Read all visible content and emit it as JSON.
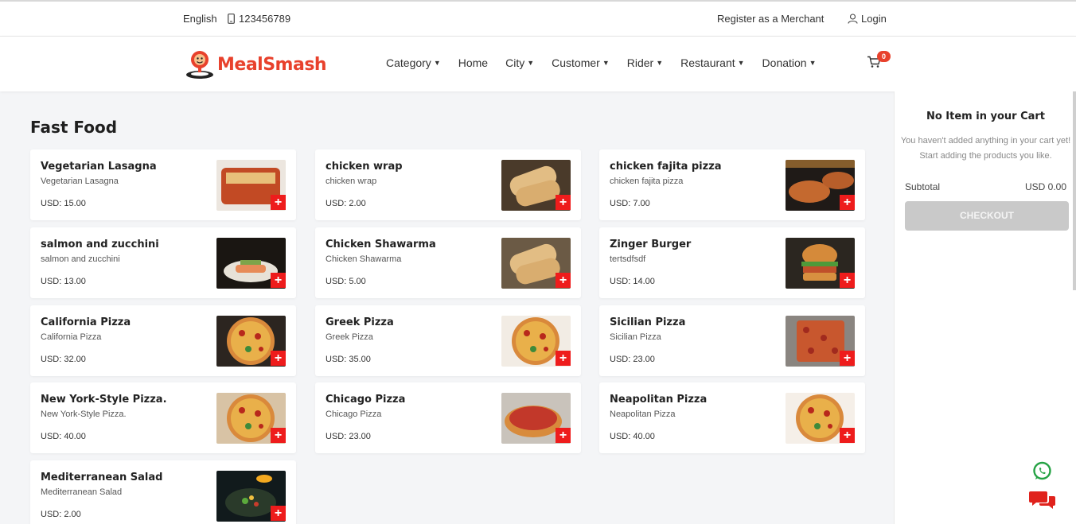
{
  "topbar": {
    "language": "English",
    "phone": "123456789",
    "register": "Register as a Merchant",
    "login": "Login"
  },
  "brand": {
    "name": "MealSmash",
    "color": "#e8412c"
  },
  "nav": {
    "items": [
      {
        "label": "Category",
        "dropdown": true
      },
      {
        "label": "Home",
        "dropdown": false
      },
      {
        "label": "City",
        "dropdown": true
      },
      {
        "label": "Customer",
        "dropdown": true
      },
      {
        "label": "Rider",
        "dropdown": true
      },
      {
        "label": "Restaurant",
        "dropdown": true
      },
      {
        "label": "Donation",
        "dropdown": true
      }
    ],
    "cart_count": "0"
  },
  "section": {
    "title": "Fast Food"
  },
  "products": [
    {
      "name": "Vegetarian Lasagna",
      "desc": "Vegetarian Lasagna",
      "price": "USD: 15.00",
      "img": "lasagna"
    },
    {
      "name": "chicken wrap",
      "desc": "chicken wrap",
      "price": "USD: 2.00",
      "img": "wrap"
    },
    {
      "name": "chicken fajita pizza",
      "desc": "chicken fajita pizza",
      "price": "USD: 7.00",
      "img": "pizza-dark"
    },
    {
      "name": "salmon and zucchini",
      "desc": "salmon and zucchini",
      "price": "USD: 13.00",
      "img": "salmon"
    },
    {
      "name": "Chicken Shawarma",
      "desc": "Chicken Shawarma",
      "price": "USD: 5.00",
      "img": "shawarma"
    },
    {
      "name": "Zinger Burger",
      "desc": "tertsdfsdf",
      "price": "USD: 14.00",
      "img": "burger"
    },
    {
      "name": "California Pizza",
      "desc": "California Pizza",
      "price": "USD: 32.00",
      "img": "pizza-pepperoni"
    },
    {
      "name": "Greek Pizza",
      "desc": "Greek Pizza",
      "price": "USD: 35.00",
      "img": "pizza-greek"
    },
    {
      "name": "Sicilian Pizza",
      "desc": "Sicilian Pizza",
      "price": "USD: 23.00",
      "img": "pizza-square"
    },
    {
      "name": "New York-Style Pizza.",
      "desc": "New York-Style Pizza.",
      "price": "USD: 40.00",
      "img": "pizza-ny"
    },
    {
      "name": "Chicago Pizza",
      "desc": "Chicago Pizza",
      "price": "USD: 23.00",
      "img": "pizza-chicago"
    },
    {
      "name": "Neapolitan Pizza",
      "desc": "Neapolitan Pizza",
      "price": "USD: 40.00",
      "img": "pizza-neapolitan"
    },
    {
      "name": "Mediterranean Salad",
      "desc": "Mediterranean Salad",
      "price": "USD: 2.00",
      "img": "salad"
    }
  ],
  "cart": {
    "title": "No Item in your Cart",
    "message": "You haven't added anything in your cart yet! Start adding the products you like.",
    "subtotal_label": "Subtotal",
    "subtotal_value": "USD 0.00",
    "checkout_label": "CHECKOUT"
  },
  "colors": {
    "add_button": "#ee1c1c",
    "whatsapp": "#25a244",
    "chat": "#e0221c"
  }
}
